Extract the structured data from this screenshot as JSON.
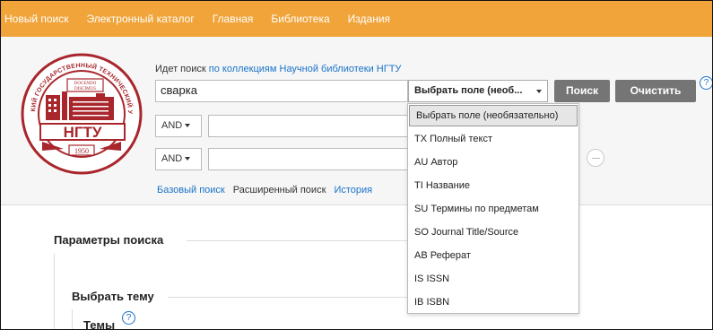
{
  "topnav": {
    "items": [
      "Новый поиск",
      "Электронный каталог",
      "Главная",
      "Библиотека",
      "Издания"
    ]
  },
  "logo": {
    "top_text": "НОВОСИБИРСКИЙ ГОСУДАРСТВЕННЫЙ ТЕХНИЧЕСКИЙ УНИВЕРСИТЕТ",
    "motto_1": "DOCENDO",
    "motto_2": "DISCIMUS",
    "name": "НГТУ",
    "year": "1950"
  },
  "search": {
    "caption_prefix": "Идет поиск",
    "caption_link": "по коллекциям Научной библиотеки НГТУ",
    "query": "сварка",
    "field_select": "Выбрать поле (необ...",
    "row2_op": "AND",
    "row3_op": "AND",
    "row2_value": "",
    "row3_value": "",
    "search_button": "Поиск",
    "clear_button": "Очистить",
    "help": "?"
  },
  "links": {
    "basic": "Базовый поиск",
    "advanced": "Расширенный поиск",
    "history": "История"
  },
  "dropdown": {
    "items": [
      "Выбрать поле (необязательно)",
      "TX Полный текст",
      "AU Автор",
      "TI Название",
      "SU Термины по предметам",
      "SO Journal Title/Source",
      "AB Реферат",
      "IS ISSN",
      "IB ISBN"
    ]
  },
  "params": {
    "title": "Параметры поиска",
    "topic_title": "Выбрать тему",
    "themes_label": "Темы",
    "help": "?"
  },
  "colors": {
    "nav_bg": "#f0a43a",
    "link": "#1a73c8",
    "button_bg": "#757575",
    "logo_red": "#a8262c"
  }
}
